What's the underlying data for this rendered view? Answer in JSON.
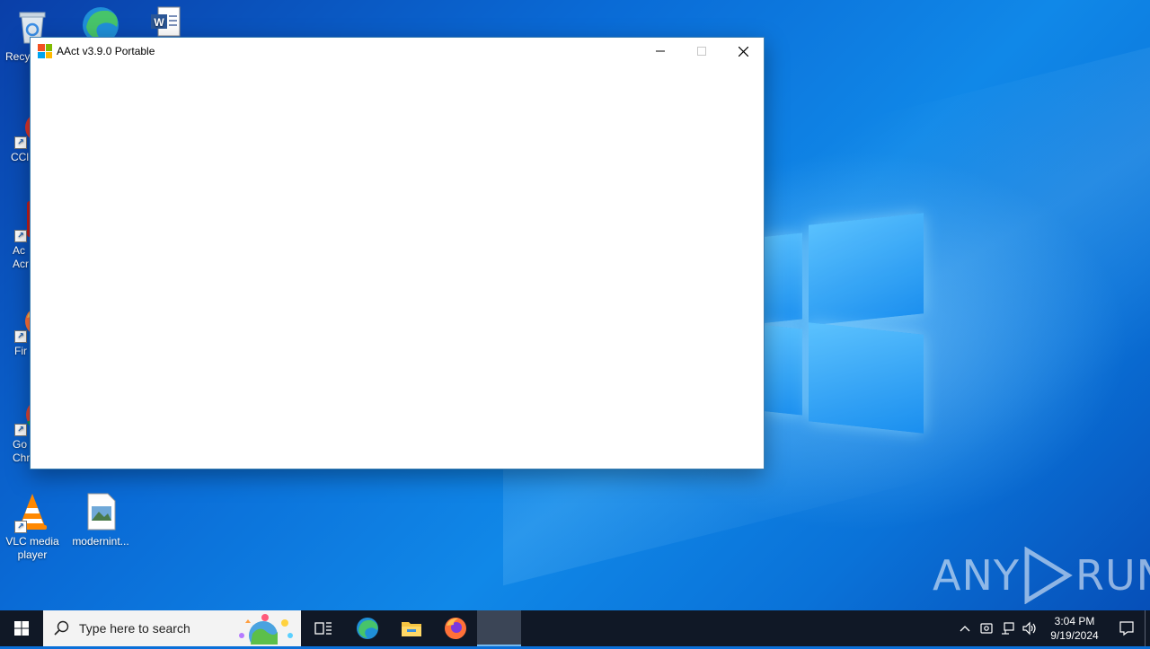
{
  "window": {
    "title": "AAct v3.9.0 Portable",
    "logo_colors": [
      "#f25022",
      "#7fba00",
      "#00a4ef",
      "#ffb900"
    ]
  },
  "desktop": {
    "icons": [
      {
        "label": "Recy",
        "icon": "recycle-bin-icon"
      },
      {
        "label": "",
        "icon": "edge-icon"
      },
      {
        "label": "",
        "icon": "word-document-icon"
      },
      {
        "label": "CCl",
        "icon": "ccleaner-icon"
      },
      {
        "label": "Ac\nAcr",
        "icon": "acrobat-icon"
      },
      {
        "label": "Fir",
        "icon": "firefox-icon"
      },
      {
        "label": "Go\nChr",
        "icon": "chrome-icon"
      },
      {
        "label": "VLC media\nplayer",
        "icon": "vlc-icon"
      },
      {
        "label": "modernint...",
        "icon": "image-file-icon"
      }
    ]
  },
  "watermark": {
    "left": "ANY",
    "right": "RUN"
  },
  "taskbar": {
    "search_placeholder": "Type here to search",
    "pinned": [
      "task-view",
      "edge",
      "file-explorer",
      "firefox",
      "aact-active"
    ],
    "clock_time": "3:04 PM",
    "clock_date": "9/19/2024"
  },
  "colors": {
    "taskbar": "#101826",
    "accent": "#76b9ed",
    "window_border": "#3c7fb1"
  }
}
